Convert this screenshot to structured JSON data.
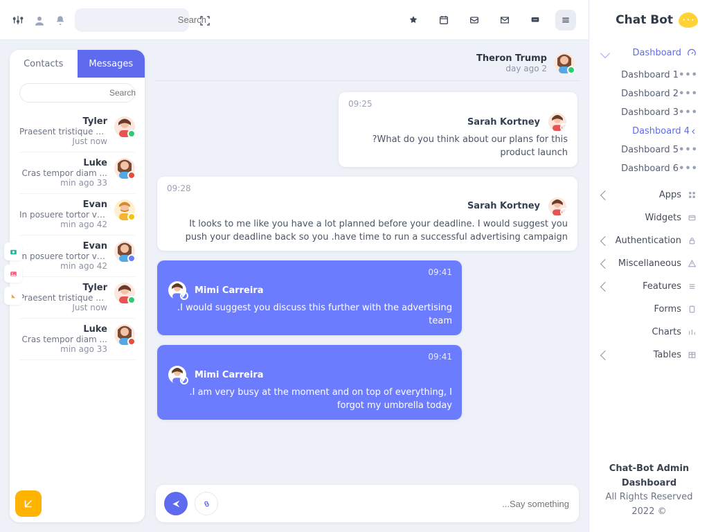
{
  "brand": {
    "name": "Chat Bot"
  },
  "top": {
    "search_placeholder": "Search"
  },
  "nav": {
    "dashboard": "Dashboard",
    "dash_items": [
      {
        "label": "Dashboard 1",
        "active": false
      },
      {
        "label": "Dashboard 2",
        "active": false
      },
      {
        "label": "Dashboard 3",
        "active": false
      },
      {
        "label": "Dashboard 4",
        "active": true
      },
      {
        "label": "Dashboard 5",
        "active": false
      },
      {
        "label": "Dashboard 6",
        "active": false
      }
    ],
    "apps": "Apps",
    "widgets": "Widgets",
    "auth": "Authentication",
    "misc": "Miscellaneous",
    "features": "Features",
    "forms": "Forms",
    "charts": "Charts",
    "tables": "Tables"
  },
  "footer": {
    "line1": "Chat-Bot Admin Dashboard",
    "line2": "All Rights Reserved 2022 ©"
  },
  "tabs": {
    "contacts": "Contacts",
    "messages": "Messages",
    "active": "messages"
  },
  "contact_search_placeholder": "Search",
  "contacts": [
    {
      "name": "Tyler",
      "snippet": "Praesent tristique diam...",
      "time": "Just now",
      "status": "online",
      "av": 0
    },
    {
      "name": "Luke",
      "snippet": "Cras tempor diam ...",
      "time": "min ago 33",
      "status": "busy",
      "av": 1
    },
    {
      "name": "Evan",
      "snippet": "In posuere tortor vel...",
      "time": "min ago 42",
      "status": "away",
      "av": 2
    },
    {
      "name": "Evan",
      "snippet": "In posuere tortor vel...",
      "time": "min ago 42",
      "status": "idle",
      "av": 1
    },
    {
      "name": "Tyler",
      "snippet": "Praesent tristique diam...",
      "time": "Just now",
      "status": "online",
      "av": 0
    },
    {
      "name": "Luke",
      "snippet": "Cras tempor diam ...",
      "time": "min ago 33",
      "status": "busy",
      "av": 1
    }
  ],
  "chat": {
    "peer": {
      "name": "Theron Trump",
      "sub": "day ago 2",
      "status": "online",
      "av": 1
    },
    "messages": [
      {
        "side": "them",
        "wide": "narrow",
        "time": "09:25",
        "author": "Sarah Kortney",
        "av": 0,
        "text": "?What do you think about our plans for this product launch"
      },
      {
        "side": "them",
        "wide": "full",
        "time": "09:28",
        "author": "Sarah Kortney",
        "av": 0,
        "text": "It looks to me like you have a lot planned before your deadline. I would suggest you push your deadline back so you .have time to run a successful advertising campaign"
      },
      {
        "side": "me",
        "wide": "me",
        "time": "09:41",
        "author": "Mimi Carreira",
        "av": 3,
        "text": ".I would suggest you discuss this further with the advertising team"
      },
      {
        "side": "me",
        "wide": "me",
        "time": "09:41",
        "author": "Mimi Carreira",
        "av": 3,
        "text": ".I am very busy at the moment and on top of everything, I forgot my umbrella today"
      }
    ],
    "composer_placeholder": "...Say something"
  }
}
